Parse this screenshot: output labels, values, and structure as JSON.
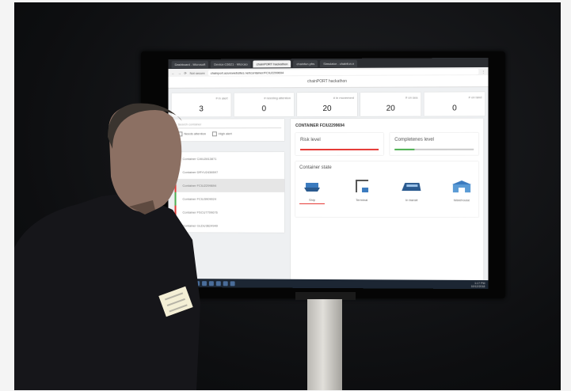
{
  "browser": {
    "tabs": [
      "Dashboard - Microsoft",
      "Device-C6621 - Microso",
      "chainPORT hackathon",
      "chainfun.pfrs",
      "Simulator - chainfun.n"
    ],
    "active_tab_index": 2,
    "security": "Not secure",
    "url": "chainport.azurewebsites.net/container/FCIU2299694"
  },
  "app": {
    "title": "chainPORT hackathon",
    "stats": [
      {
        "label": "# in alert",
        "value": "3"
      },
      {
        "label": "# needing attention",
        "value": "0"
      },
      {
        "label": "# in movement",
        "value": "20"
      },
      {
        "label": "# on sea",
        "value": "20"
      },
      {
        "label": "# on land",
        "value": "0"
      }
    ],
    "search_placeholder": "Search container",
    "filter_needs_attention": "Needs attention",
    "filter_high_alert": "High alert",
    "containers": [
      {
        "label": "Container CAIU2813871",
        "status": "green"
      },
      {
        "label": "Container DRYU2438597",
        "status": "green"
      },
      {
        "label": "Container FCIU2299694",
        "status": "red",
        "selected": true
      },
      {
        "label": "Container FCIU3909024",
        "status": "green"
      },
      {
        "label": "Container FSCU7709676",
        "status": "red"
      },
      {
        "label": "Container GLDU3624949",
        "status": "green"
      }
    ],
    "detail_title": "CONTAINER FCIU2299694",
    "risk_label": "Risk level",
    "completeness_label": "Completenes level",
    "state_title": "Container state",
    "steps": [
      "Ship",
      "Terminal",
      "In transit",
      "Warehouse"
    ],
    "current_step_index": 0,
    "colors": {
      "alert": "#e53935",
      "ok": "#4caf50"
    }
  },
  "taskbar": {
    "time": "1:17 PM",
    "date": "10/12/2018"
  }
}
